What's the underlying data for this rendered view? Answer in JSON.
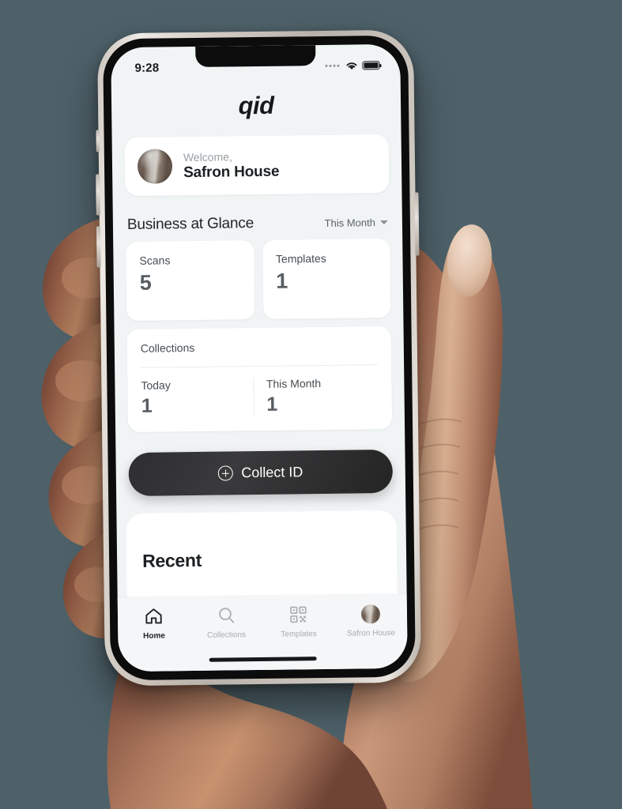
{
  "status_bar": {
    "time": "9:28",
    "signal_icon": "signal-dots-icon",
    "wifi_icon": "wifi-icon",
    "battery_icon": "battery-full-icon"
  },
  "brand": {
    "logo_text": "qid"
  },
  "welcome_card": {
    "greeting": "Welcome,",
    "name": "Safron House",
    "avatar_icon": "user-avatar"
  },
  "section": {
    "title": "Business at Glance",
    "period_label": "This Month",
    "period_chevron": "chevron-down-icon"
  },
  "stats": [
    {
      "label": "Scans",
      "value": "5"
    },
    {
      "label": "Templates",
      "value": "1"
    }
  ],
  "collections": {
    "title": "Collections",
    "cells": [
      {
        "label": "Today",
        "value": "1"
      },
      {
        "label": "This Month",
        "value": "1"
      }
    ]
  },
  "collect_button": {
    "label": "Collect ID",
    "icon": "plus-circle-icon"
  },
  "recent": {
    "title": "Recent"
  },
  "tabbar": {
    "items": [
      {
        "label": "Home",
        "icon": "home-icon",
        "active": true
      },
      {
        "label": "Collections",
        "icon": "search-icon",
        "active": false
      },
      {
        "label": "Templates",
        "icon": "qr-code-icon",
        "active": false
      },
      {
        "label": "Safron House",
        "icon": "user-avatar",
        "active": false
      }
    ]
  },
  "colors": {
    "screen_background": "#f1f4f5",
    "card_background": "#ffffff",
    "primary_text": "#1c2023",
    "muted_text": "#9aa0a4",
    "button_dark": "#2e2e30",
    "tabbar_background": "#f4f6f7",
    "backdrop": "#4e6169"
  }
}
